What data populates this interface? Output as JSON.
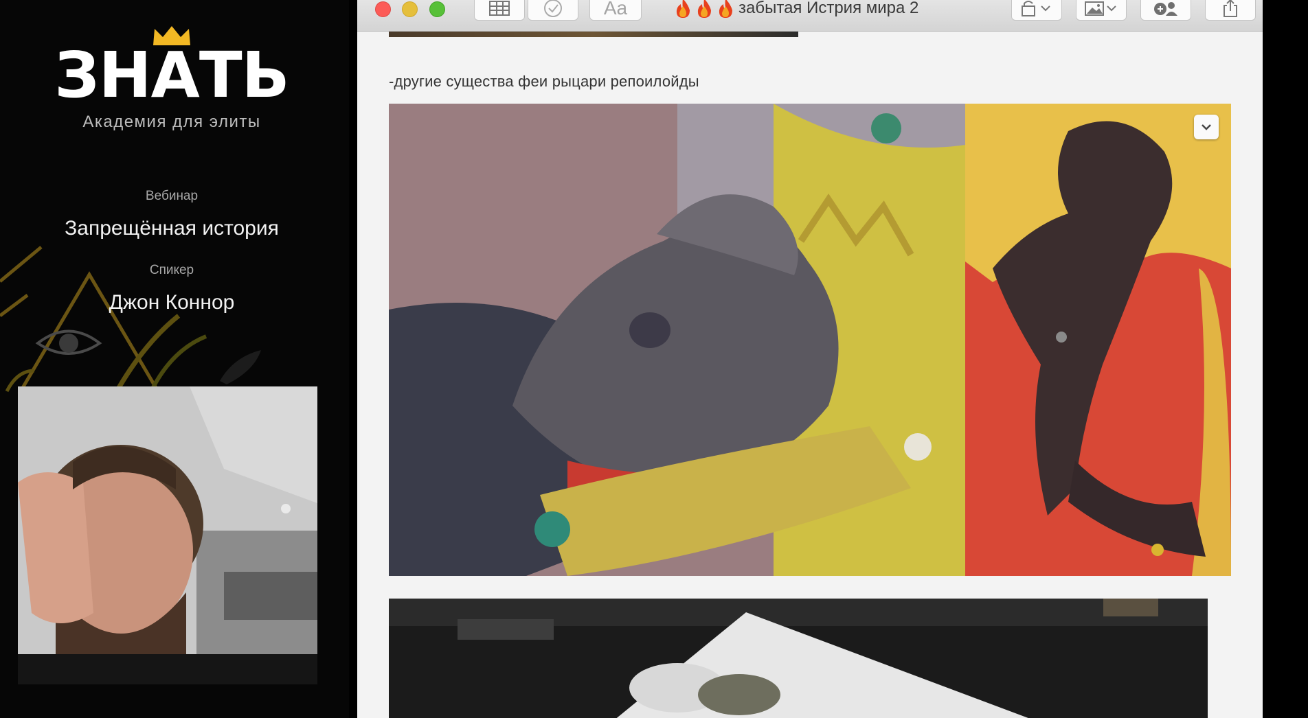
{
  "sidebar": {
    "logo": "ЗНАТЬ",
    "tagline": "Академия для элиты",
    "webinar_label": "Вебинар",
    "webinar_title": "Запрещённая история",
    "speaker_label": "Спикер",
    "speaker_name": "Джон Коннор"
  },
  "window": {
    "title": "забытая Истрия мира 2",
    "toolbar": {
      "format_label": "Aa",
      "table_icon": "table-icon",
      "checklist_icon": "checklist-icon",
      "lock_icon": "lock-icon",
      "media_icon": "photo-icon",
      "collab_icon": "add-people-icon",
      "share_icon": "share-icon"
    },
    "traffic_colors": {
      "close": "#fc5b57",
      "minimize": "#e5bf3c",
      "maximize": "#57c038"
    }
  },
  "note": {
    "text": "-другие существа феи рыцари репоилойды"
  },
  "colors": {
    "sidebar_bg": "#060606",
    "note_bg": "#f3f3f3",
    "crown": "#f2b824"
  }
}
